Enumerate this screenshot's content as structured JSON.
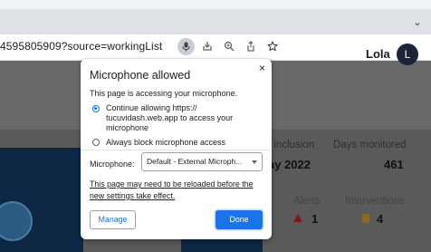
{
  "browser": {
    "url_fragment": "4595805909?source=workingList",
    "omnibox_icons": [
      "microphone-icon",
      "install-icon",
      "zoom-icon",
      "share-icon",
      "bookmark-star-icon"
    ]
  },
  "page": {
    "user_name": "Lola",
    "avatar_initial": "L",
    "stats": {
      "inclusion_label": "f inclusion",
      "inclusion_value": "ay 2022",
      "days_monitored_label": "Days monitored",
      "days_monitored_value": "461",
      "alerts_label": "Alerts",
      "alerts_value": "1",
      "interventions_label": "Interventions",
      "interventions_value": "4"
    }
  },
  "popup": {
    "title": "Microphone allowed",
    "close": "×",
    "subtitle": "This page is accessing your microphone.",
    "option_allow_line1": "Continue allowing https://",
    "option_allow_line2": "tucuvidash.web.app to access your",
    "option_allow_line3": "microphone",
    "option_block": "Always block microphone access",
    "mic_label": "Microphone:",
    "mic_selected": "Default - External Microph...",
    "reload_line1": "This page may need to be reloaded before the",
    "reload_line2": "new settings take effect.",
    "manage_label": "Manage",
    "done_label": "Done"
  }
}
